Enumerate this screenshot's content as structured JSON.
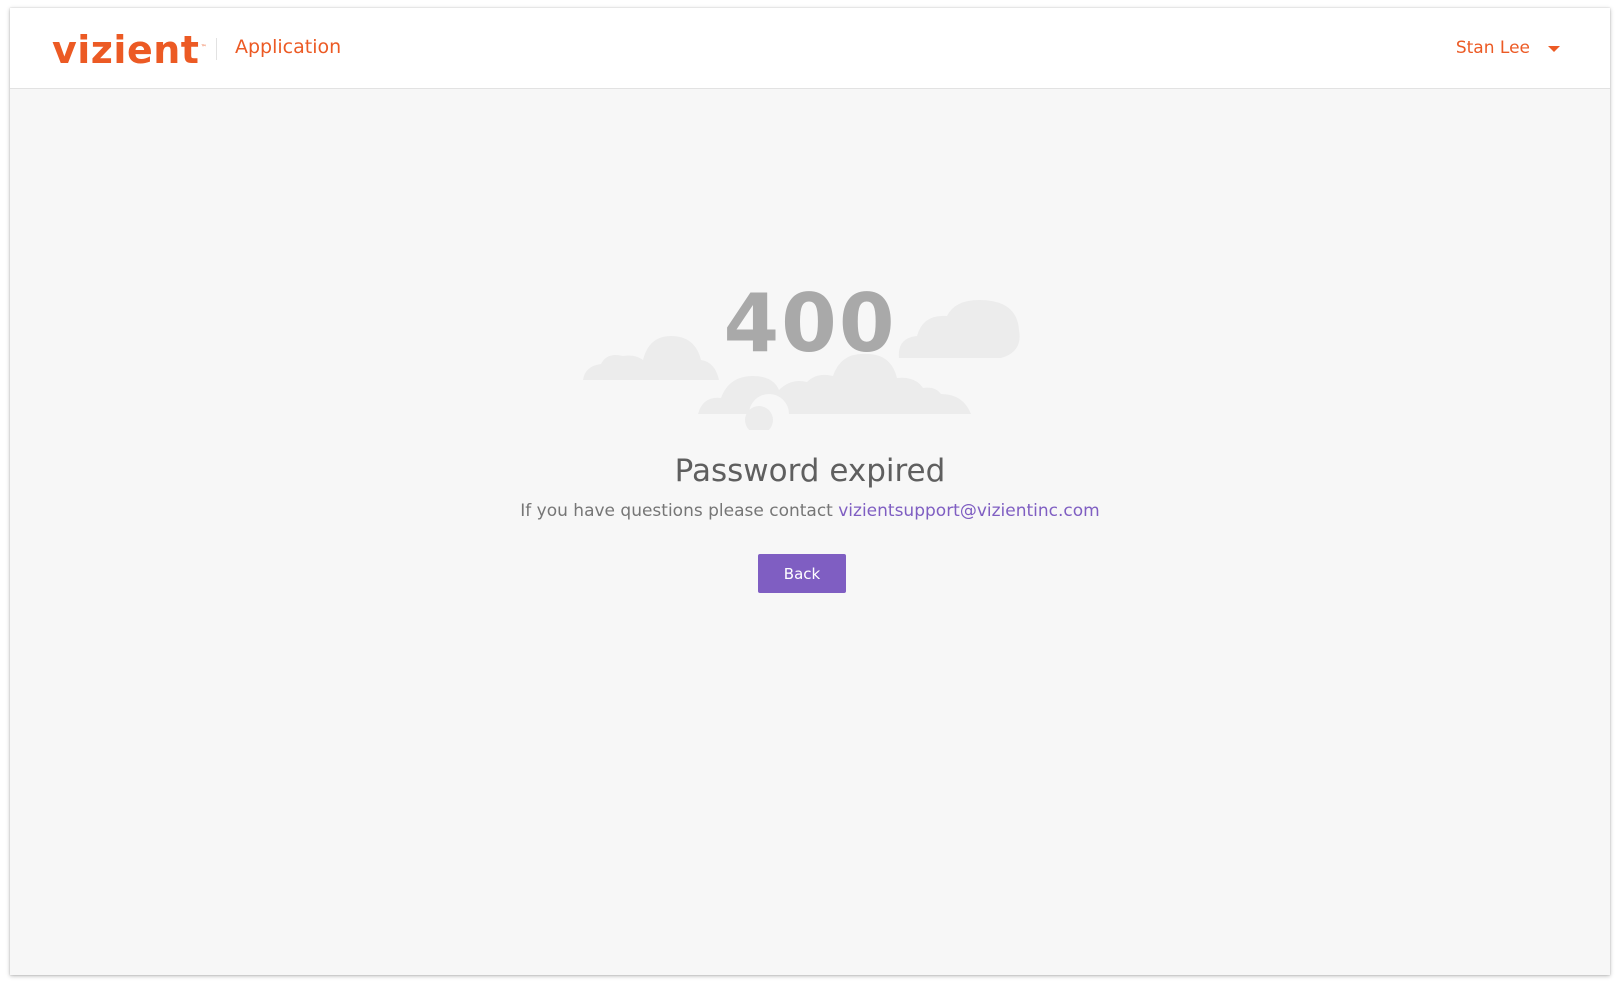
{
  "header": {
    "logo_text": "vizient",
    "logo_tm": "™",
    "app_title": "Application",
    "user_name": "Stan Lee"
  },
  "error": {
    "code": "400",
    "headline": "Password expired",
    "message_prefix": "If you have questions please contact ",
    "support_email": "vizientsupport@vizientinc.com",
    "back_label": "Back"
  },
  "colors": {
    "brand_orange": "#ec5a24",
    "accent_purple": "#7f5ec2",
    "page_background": "#f7f7f7",
    "cloud": "#ececec"
  },
  "icons": {
    "user_menu": "caret-down-icon",
    "illustration": "clouds-illustration"
  }
}
